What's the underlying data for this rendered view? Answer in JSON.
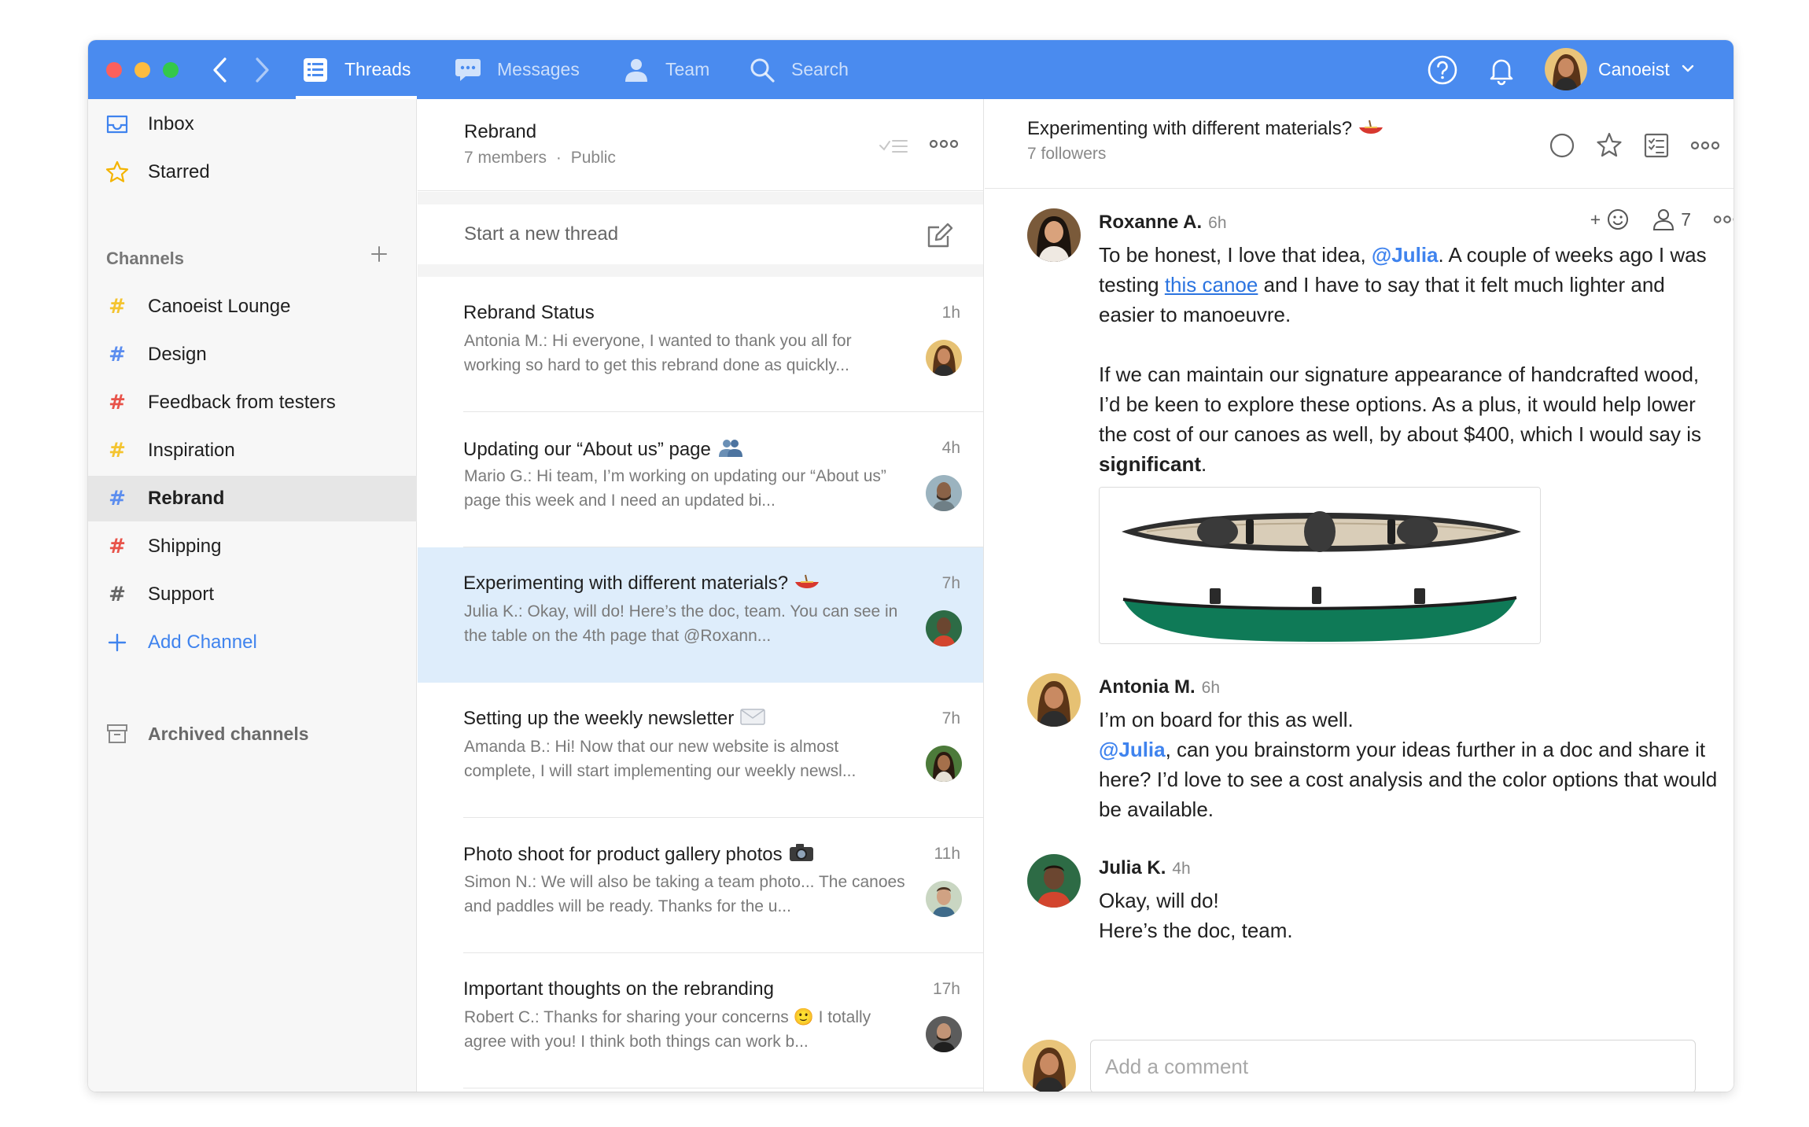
{
  "colors": {
    "topbar": "#4a8bef",
    "accent": "#3f83ee",
    "selected_thread": "#deedfb",
    "sidebar_bg": "#f7f7f7",
    "hash_yellow": "#f4c430",
    "hash_blue": "#5b8def",
    "hash_red": "#e8534a",
    "hash_gray": "#666666"
  },
  "topbar": {
    "tabs": [
      {
        "label": "Threads",
        "icon": "list-icon",
        "active": true
      },
      {
        "label": "Messages",
        "icon": "chat-icon",
        "active": false
      },
      {
        "label": "Team",
        "icon": "person-icon",
        "active": false
      },
      {
        "label": "Search",
        "icon": "search-icon",
        "active": false
      }
    ],
    "user_name": "Canoeist"
  },
  "sidebar": {
    "inbox": "Inbox",
    "starred": "Starred",
    "channels_header": "Channels",
    "channels": [
      {
        "name": "Canoeist Lounge",
        "hash_color": "#f4c430"
      },
      {
        "name": "Design",
        "hash_color": "#5b8def"
      },
      {
        "name": "Feedback from testers",
        "hash_color": "#e8534a"
      },
      {
        "name": "Inspiration",
        "hash_color": "#f4c430"
      },
      {
        "name": "Rebrand",
        "hash_color": "#5b8def",
        "active": true
      },
      {
        "name": "Shipping",
        "hash_color": "#e8534a"
      },
      {
        "name": "Support",
        "hash_color": "#666666"
      }
    ],
    "add_channel": "Add Channel",
    "archived": "Archived channels"
  },
  "threadlist": {
    "channel_name": "Rebrand",
    "members": "7 members",
    "separator": "·",
    "visibility": "Public",
    "compose_placeholder": "Start a new thread",
    "threads": [
      {
        "title": "Rebrand Status",
        "time": "1h",
        "preview": "Antonia M.: Hi everyone, I wanted to thank you all for working so hard to get this rebrand done as quickly...",
        "emoji": ""
      },
      {
        "title": "Updating our “About us” page",
        "time": "4h",
        "preview": "Mario G.: Hi team, I’m working on updating our “About us” page this week and I need an updated bi...",
        "emoji": "people"
      },
      {
        "title": "Experimenting with different materials?",
        "time": "7h",
        "preview": "Julia K.: Okay, will do! Here’s the doc, team.  You can see in the table on the 4th page that @Roxann...",
        "emoji": "canoe",
        "active": true
      },
      {
        "title": "Setting up the weekly newsletter",
        "time": "7h",
        "preview": "Amanda B.: Hi! Now that our new website is almost complete, I will start implementing our weekly newsl...",
        "emoji": "envelope"
      },
      {
        "title": "Photo shoot for product gallery photos",
        "time": "11h",
        "preview": "Simon N.: We will also be taking a team photo... The canoes and paddles will be ready. Thanks for the u...",
        "emoji": "camera"
      },
      {
        "title": "Important thoughts on the rebranding",
        "time": "17h",
        "preview": "Robert C.: Thanks for sharing your concerns 🙂 I totally agree with you! I think both things can work b...",
        "emoji": ""
      }
    ]
  },
  "conversation": {
    "title": "Experimenting with different materials?",
    "followers": "7 followers",
    "messages": [
      {
        "author": "Roxanne A.",
        "time": "6h",
        "reactions_label": "+",
        "follower_count": "7",
        "p1_a": "To be honest, I love that idea, ",
        "p1_mention": "@Julia",
        "p1_b": ". A couple of weeks ago I was testing ",
        "p1_link": "this canoe",
        "p1_c": " and I have to say that it felt much lighter and easier to manoeuvre.",
        "p2_a": "If we can maintain our signature appearance of handcrafted wood, I’d be keen to explore these options. As a plus, it would help lower the cost of our canoes as well, by about $400, which I would say is ",
        "p2_bold": "significant",
        "p2_b": "."
      },
      {
        "author": "Antonia M.",
        "time": "6h",
        "p1": "I’m on board for this as well.",
        "p2_mention": "@Julia",
        "p2_b": ", can you brainstorm your ideas further in a doc and share it here? I’d love to see a cost analysis and the color options that would be available."
      },
      {
        "author": "Julia K.",
        "time": "4h",
        "p1": "Okay, will do!",
        "p2": "Here’s the doc, team."
      }
    ],
    "comment_placeholder": "Add a comment"
  }
}
